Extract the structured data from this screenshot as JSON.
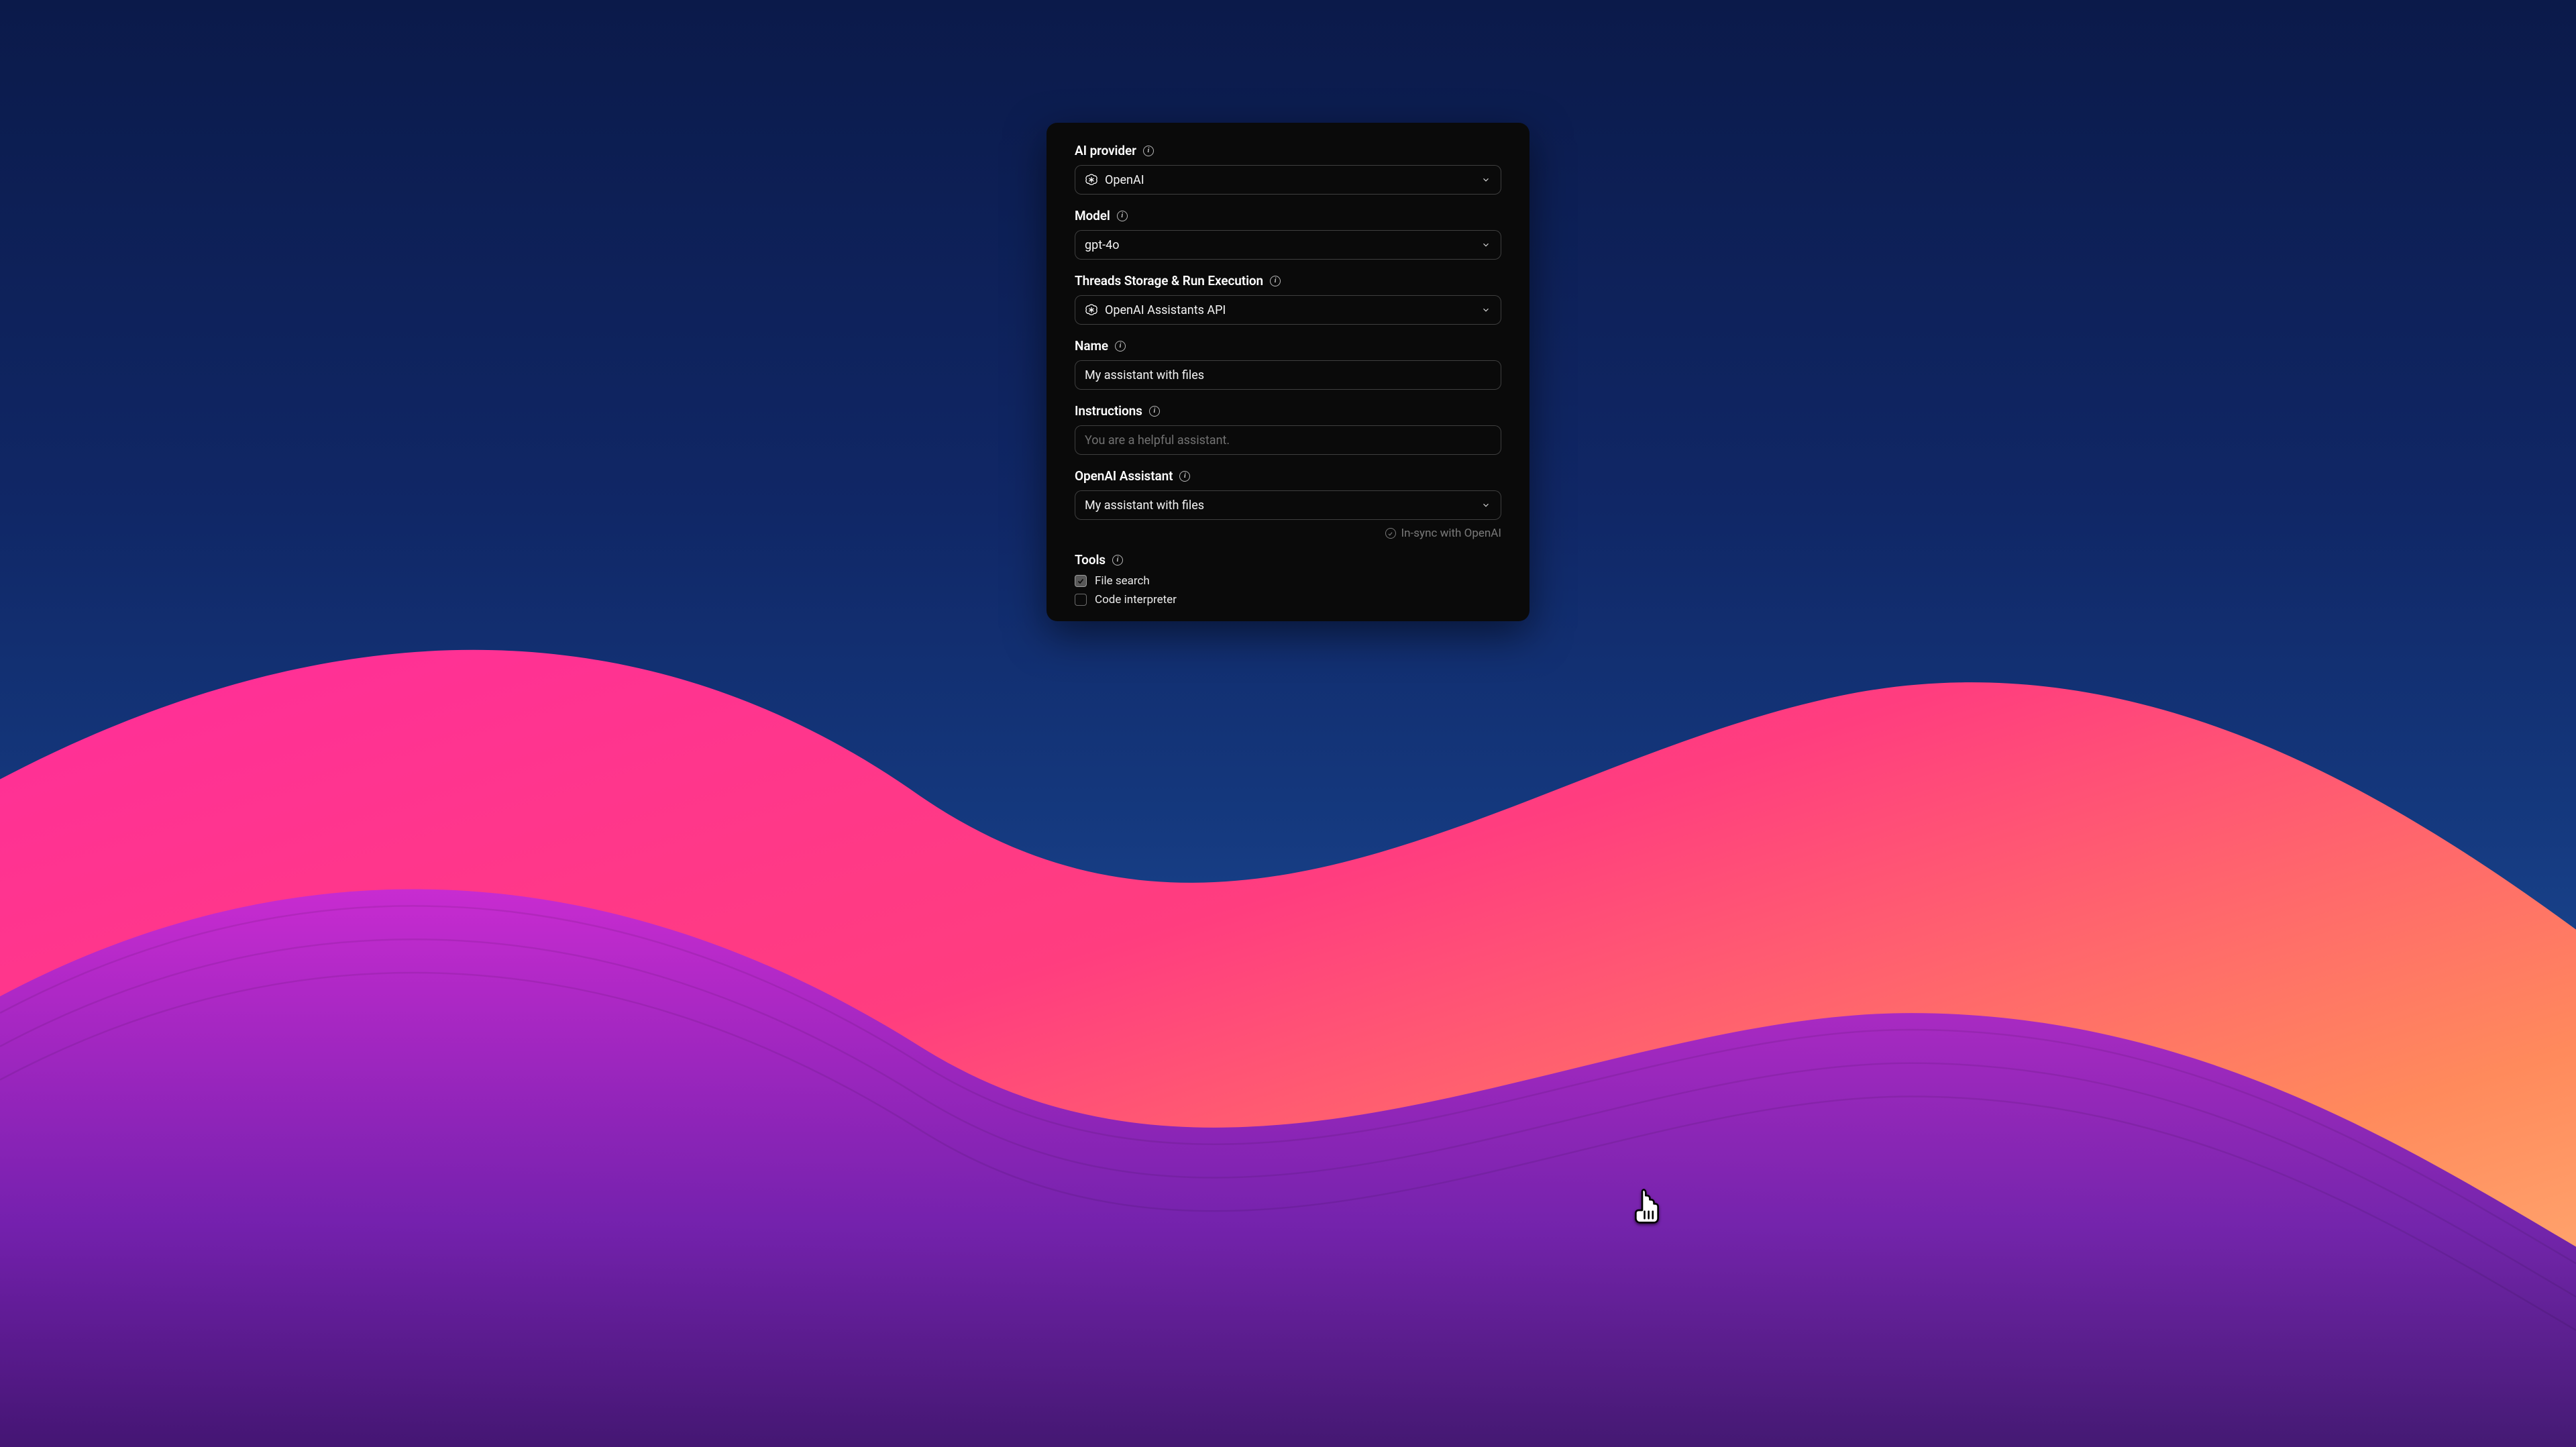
{
  "fields": {
    "provider": {
      "label": "AI provider",
      "value": "OpenAI"
    },
    "model": {
      "label": "Model",
      "value": "gpt-4o"
    },
    "storage": {
      "label": "Threads Storage & Run Execution",
      "value": "OpenAI Assistants API"
    },
    "name": {
      "label": "Name",
      "value": "My assistant with files"
    },
    "instructions": {
      "label": "Instructions",
      "placeholder": "You are a helpful assistant.",
      "value": ""
    },
    "assistant": {
      "label": "OpenAI Assistant",
      "value": "My assistant with files"
    }
  },
  "sync_status": "In-sync with OpenAI",
  "tools": {
    "label": "Tools",
    "items": [
      {
        "label": "File search",
        "checked": true
      },
      {
        "label": "Code interpreter",
        "checked": false
      }
    ]
  }
}
